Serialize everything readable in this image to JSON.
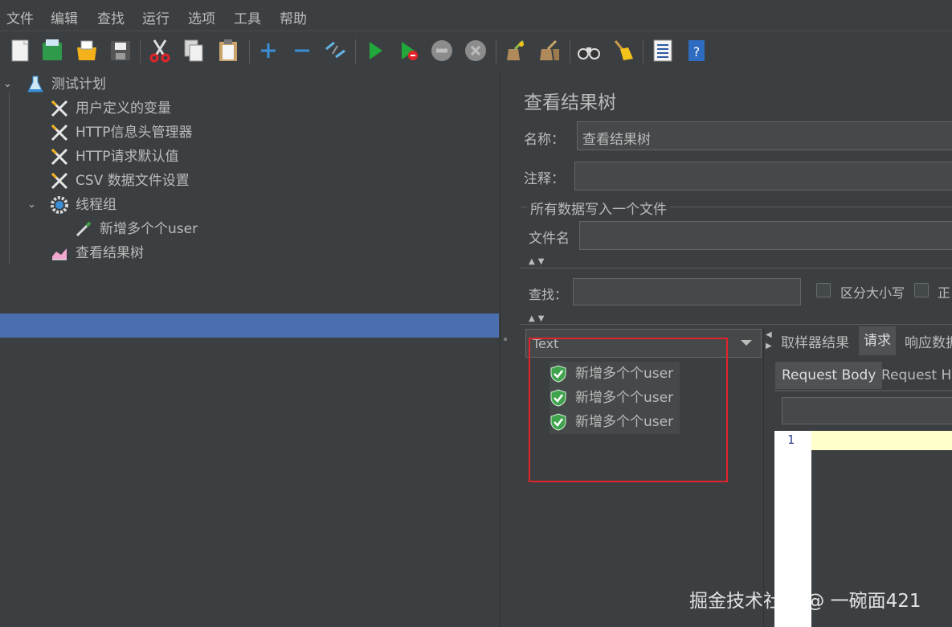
{
  "menu": [
    "文件",
    "编辑",
    "查找",
    "运行",
    "选项",
    "工具",
    "帮助"
  ],
  "tree": {
    "items": [
      {
        "label": "测试计划"
      },
      {
        "label": "用户定义的变量"
      },
      {
        "label": "HTTP信息头管理器"
      },
      {
        "label": "HTTP请求默认值"
      },
      {
        "label": "CSV 数据文件设置"
      },
      {
        "label": "线程组"
      },
      {
        "label": "新增多个个user"
      },
      {
        "label": "查看结果树"
      }
    ]
  },
  "panel": {
    "title": "查看结果树",
    "name_label": "名称：",
    "name_value": "查看结果树",
    "comment_label": "注释：",
    "comment_value": "",
    "file_section": "所有数据写入一个文件",
    "file_label": "文件名",
    "file_value": "",
    "search_label": "查找：",
    "search_value": "",
    "case_sensitive": "区分大小写",
    "regex_partial": "正",
    "renderer_selected": "Text",
    "results": [
      "新增多个个user",
      "新增多个个user",
      "新增多个个user"
    ],
    "tabs": [
      "取样器结果",
      "请求",
      "响应数据"
    ],
    "active_tab": "请求",
    "subtabs": [
      "Request Body",
      "Request Headers"
    ],
    "line_number": "1"
  },
  "watermark": "掘金技术社区 @ 一碗面421",
  "colors": {
    "background": "#3c3f41",
    "selection": "#4b6eaf",
    "highlight_box": "#e0242a",
    "current_line": "#ffffcc",
    "success_green": "#3fa34d"
  },
  "icons": {
    "tree": [
      "flask-icon",
      "wrench-icon",
      "wrench-icon",
      "wrench-icon",
      "wrench-icon",
      "gear-icon",
      "pipette-icon",
      "graph-icon"
    ],
    "results": "green-shield-check-icon"
  }
}
